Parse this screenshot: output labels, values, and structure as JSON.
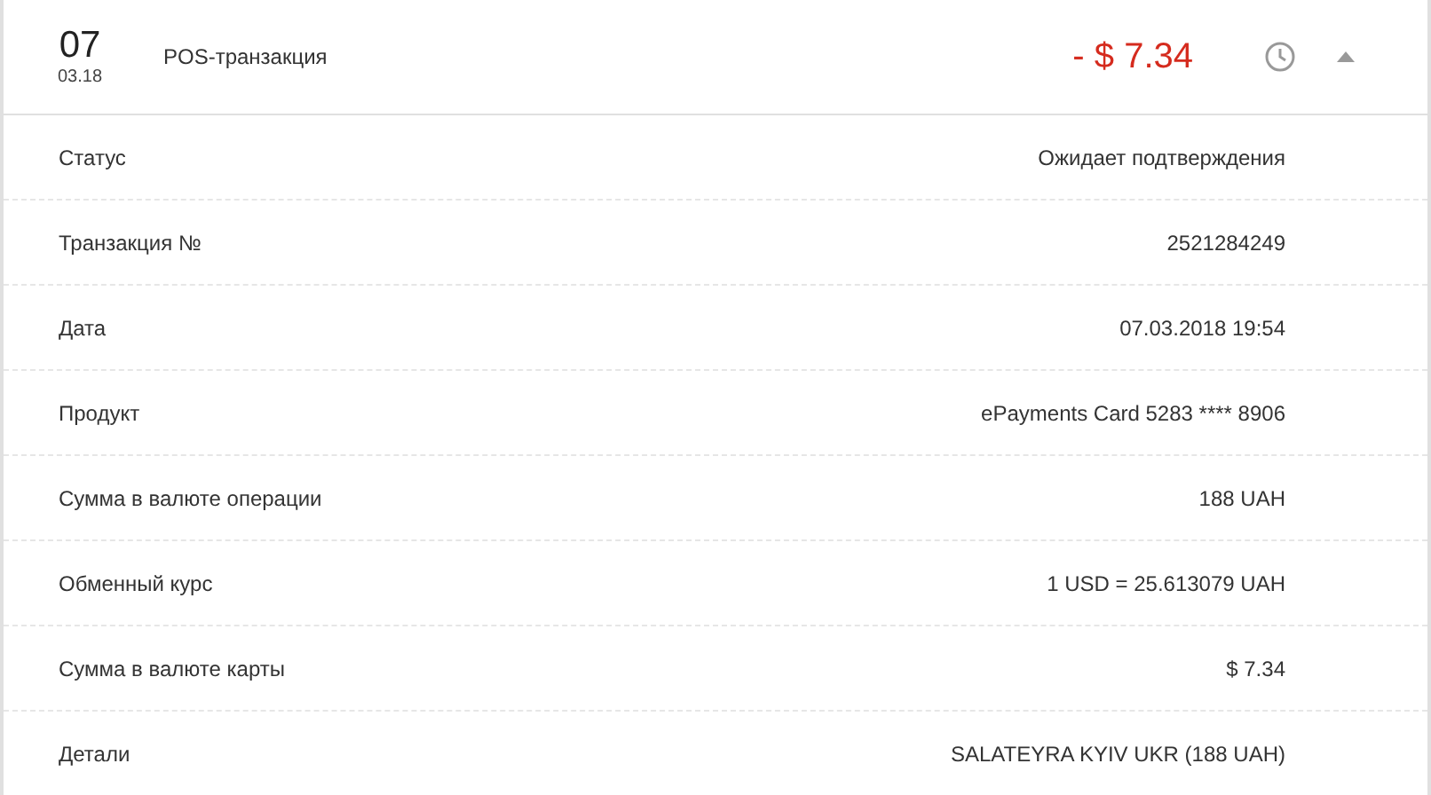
{
  "transaction": {
    "day": "07",
    "month_year": "03.18",
    "title": "POS-транзакция",
    "amount": "- $ 7.34",
    "expanded": true
  },
  "details": [
    {
      "label": "Статус",
      "value": "Ожидает подтверждения"
    },
    {
      "label": "Транзакция №",
      "value": "2521284249"
    },
    {
      "label": "Дата",
      "value": "07.03.2018 19:54"
    },
    {
      "label": "Продукт",
      "value": "ePayments Card 5283 **** 8906"
    },
    {
      "label": "Сумма в валюте операции",
      "value": "188 UAH"
    },
    {
      "label": "Обменный курс",
      "value": "1 USD = 25.613079 UAH"
    },
    {
      "label": "Сумма в валюте карты",
      "value": "$ 7.34"
    },
    {
      "label": "Детали",
      "value": "SALATEYRA KYIV UKR (188 UAH)"
    }
  ]
}
